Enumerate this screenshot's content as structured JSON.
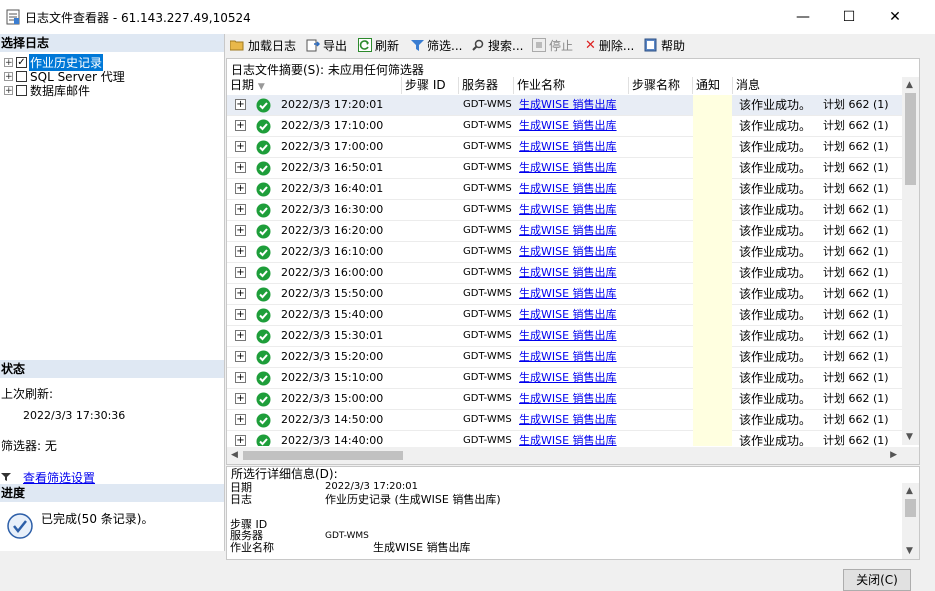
{
  "window": {
    "title": "日志文件查看器 - 61.143.227.49,10524",
    "minimize": "—",
    "maximize": "☐",
    "close": "✕"
  },
  "left": {
    "select_log_header": "选择日志",
    "tree": [
      {
        "label": "作业历史记录",
        "checked": true,
        "selected": true
      },
      {
        "label": "SQL Server 代理",
        "checked": false,
        "selected": false
      },
      {
        "label": "数据库邮件",
        "checked": false,
        "selected": false
      }
    ],
    "status_header": "状态",
    "last_refresh_label": "上次刷新:",
    "last_refresh_value": "2022/3/3 17:30:36",
    "filter_label": "筛选器: 无",
    "view_filter_link": "查看筛选设置",
    "progress_header": "进度",
    "progress_text": "已完成(50 条记录)。"
  },
  "toolbar": {
    "load_log": "加载日志",
    "export": "导出",
    "refresh": "刷新",
    "filter": "筛选...",
    "search": "搜索...",
    "stop": "停止",
    "delete": "删除...",
    "help": "帮助"
  },
  "grid": {
    "summary": "日志文件摘要(S): 未应用任何筛选器",
    "columns": {
      "date": "日期",
      "step_id": "步骤 ID",
      "server": "服务器",
      "job_name": "作业名称",
      "step_name": "步骤名称",
      "notify": "通知",
      "message": "消息"
    },
    "rows": [
      {
        "date": "2022/3/3 17:20:01",
        "server": "GDT-WMS",
        "job": "生成WISE 销售出库",
        "msg": "该作业成功。",
        "extra": "计划 662 (1)"
      },
      {
        "date": "2022/3/3 17:10:00",
        "server": "GDT-WMS",
        "job": "生成WISE 销售出库",
        "msg": "该作业成功。",
        "extra": "计划 662 (1)"
      },
      {
        "date": "2022/3/3 17:00:00",
        "server": "GDT-WMS",
        "job": "生成WISE 销售出库",
        "msg": "该作业成功。",
        "extra": "计划 662 (1)"
      },
      {
        "date": "2022/3/3 16:50:01",
        "server": "GDT-WMS",
        "job": "生成WISE 销售出库",
        "msg": "该作业成功。",
        "extra": "计划 662 (1)"
      },
      {
        "date": "2022/3/3 16:40:01",
        "server": "GDT-WMS",
        "job": "生成WISE 销售出库",
        "msg": "该作业成功。",
        "extra": "计划 662 (1)"
      },
      {
        "date": "2022/3/3 16:30:00",
        "server": "GDT-WMS",
        "job": "生成WISE 销售出库",
        "msg": "该作业成功。",
        "extra": "计划 662 (1)"
      },
      {
        "date": "2022/3/3 16:20:00",
        "server": "GDT-WMS",
        "job": "生成WISE 销售出库",
        "msg": "该作业成功。",
        "extra": "计划 662 (1)"
      },
      {
        "date": "2022/3/3 16:10:00",
        "server": "GDT-WMS",
        "job": "生成WISE 销售出库",
        "msg": "该作业成功。",
        "extra": "计划 662 (1)"
      },
      {
        "date": "2022/3/3 16:00:00",
        "server": "GDT-WMS",
        "job": "生成WISE 销售出库",
        "msg": "该作业成功。",
        "extra": "计划 662 (1)"
      },
      {
        "date": "2022/3/3 15:50:00",
        "server": "GDT-WMS",
        "job": "生成WISE 销售出库",
        "msg": "该作业成功。",
        "extra": "计划 662 (1)"
      },
      {
        "date": "2022/3/3 15:40:00",
        "server": "GDT-WMS",
        "job": "生成WISE 销售出库",
        "msg": "该作业成功。",
        "extra": "计划 662 (1)"
      },
      {
        "date": "2022/3/3 15:30:01",
        "server": "GDT-WMS",
        "job": "生成WISE 销售出库",
        "msg": "该作业成功。",
        "extra": "计划 662 (1)"
      },
      {
        "date": "2022/3/3 15:20:00",
        "server": "GDT-WMS",
        "job": "生成WISE 销售出库",
        "msg": "该作业成功。",
        "extra": "计划 662 (1)"
      },
      {
        "date": "2022/3/3 15:10:00",
        "server": "GDT-WMS",
        "job": "生成WISE 销售出库",
        "msg": "该作业成功。",
        "extra": "计划 662 (1)"
      },
      {
        "date": "2022/3/3 15:00:00",
        "server": "GDT-WMS",
        "job": "生成WISE 销售出库",
        "msg": "该作业成功。",
        "extra": "计划 662 (1)"
      },
      {
        "date": "2022/3/3 14:50:00",
        "server": "GDT-WMS",
        "job": "生成WISE 销售出库",
        "msg": "该作业成功。",
        "extra": "计划 662 (1)"
      },
      {
        "date": "2022/3/3 14:40:00",
        "server": "GDT-WMS",
        "job": "生成WISE 销售出库",
        "msg": "该作业成功。",
        "extra": "计划 662 (1)"
      }
    ]
  },
  "detail": {
    "header": "所选行详细信息(D):",
    "date_label": "日期",
    "date_value": "2022/3/3 17:20:01",
    "log_label": "日志",
    "log_value": "作业历史记录 (生成WISE 销售出库)",
    "step_id_label": "步骤 ID",
    "server_label": "服务器",
    "server_value": "GDT-WMS",
    "job_name_label": "作业名称",
    "job_name_value": "生成WISE 销售出库"
  },
  "footer": {
    "close_button": "关闭(C)"
  }
}
